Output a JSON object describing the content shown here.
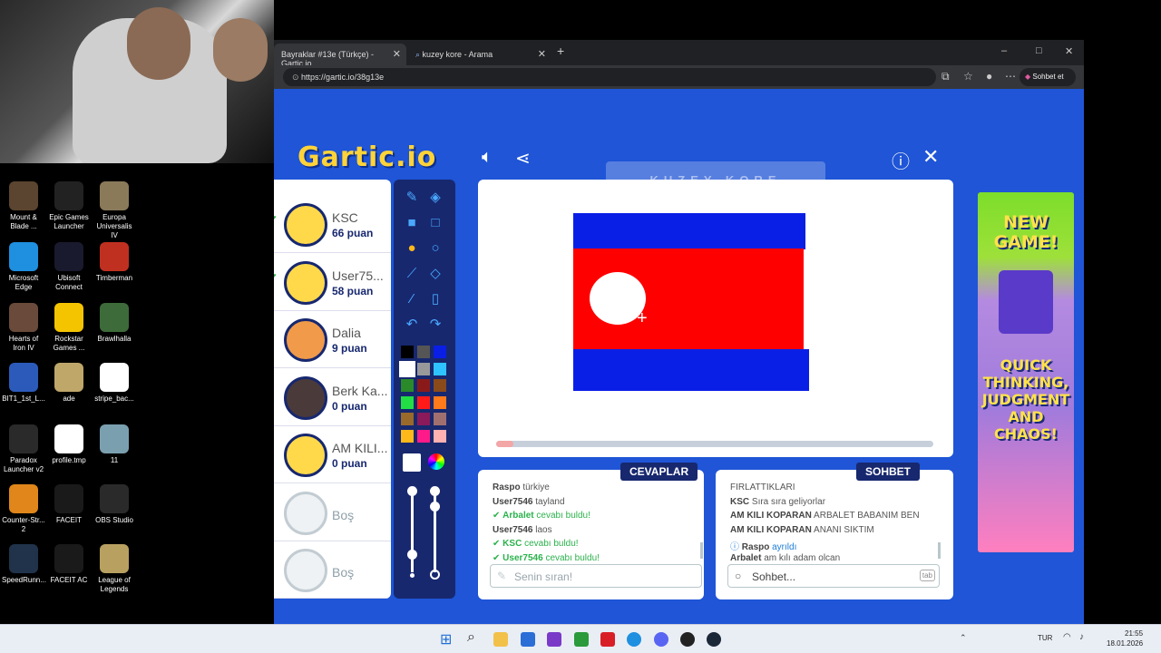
{
  "desktop": {
    "icons": [
      {
        "label": "Mount & Blade ...",
        "color": "#5b4530"
      },
      {
        "label": "Epic Games Launcher",
        "color": "#222222"
      },
      {
        "label": "Europa Universalis IV",
        "color": "#8a7a5a"
      },
      {
        "label": "Microsoft Edge",
        "color": "#1f8fe0"
      },
      {
        "label": "Ubisoft Connect",
        "color": "#1a1a2e"
      },
      {
        "label": "Timberman",
        "color": "#c03020"
      },
      {
        "label": "Hearts of Iron IV",
        "color": "#6a4a3a"
      },
      {
        "label": "Rockstar Games ...",
        "color": "#f5c400"
      },
      {
        "label": "Brawlhalla",
        "color": "#3d6b3a"
      },
      {
        "label": "BIT1_1st_L...",
        "color": "#2b5aba"
      },
      {
        "label": "ade",
        "color": "#bfa76a"
      },
      {
        "label": "stripe_bac...",
        "color": "#ffffff"
      },
      {
        "label": "Paradox Launcher v2",
        "color": "#2a2a2a"
      },
      {
        "label": "profile.tmp",
        "color": "#ffffff"
      },
      {
        "label": "11",
        "color": "#7aa0b0"
      },
      {
        "label": "Counter-Str... 2",
        "color": "#e0861a"
      },
      {
        "label": "FACEIT",
        "color": "#1a1a1a"
      },
      {
        "label": "OBS Studio",
        "color": "#2a2a2a"
      },
      {
        "label": "SpeedRunn...",
        "color": "#20334a"
      },
      {
        "label": "FACEIT AC",
        "color": "#1a1a1a"
      },
      {
        "label": "League of Legends",
        "color": "#b8a060"
      }
    ]
  },
  "browser": {
    "tabs": [
      {
        "title": "Bayraklar #13e (Türkçe) - Gartic.io"
      },
      {
        "title": "kuzey kore - Arama"
      }
    ],
    "new_tab_icon": "+",
    "window_controls": {
      "minimize": "–",
      "maximize": "□",
      "close": "✕"
    },
    "url": "https://gartic.io/38g13e",
    "copilot_label": "Sohbet et"
  },
  "game": {
    "logo": "Gartic.io",
    "hint": "KUZEY KORE",
    "players": [
      {
        "name": "KSC",
        "points": "66 puan",
        "guessed": true,
        "avatar_color": "#ffd94a"
      },
      {
        "name": "User75...",
        "points": "58 puan",
        "guessed": true,
        "avatar_color": "#ffd94a"
      },
      {
        "name": "Dalia",
        "points": "9 puan",
        "guessed": false,
        "avatar_color": "#f09a4a"
      },
      {
        "name": "Berk Ka...",
        "points": "0 puan",
        "guessed": false,
        "avatar_color": "#4a3a3a"
      },
      {
        "name": "AM KILI...",
        "points": "0 puan",
        "guessed": false,
        "avatar_color": "#ffd94a"
      },
      {
        "name": "Boş",
        "points": "",
        "guessed": false,
        "empty": true
      },
      {
        "name": "Boş",
        "points": "",
        "guessed": false,
        "empty": true
      }
    ],
    "palette": [
      "#000000",
      "#555555",
      "#0a1fe6",
      "#ffffff",
      "#999999",
      "#2ec3ff",
      "#2a8a2a",
      "#8a1a1a",
      "#8a4a1a",
      "#22dd44",
      "#ff1a1a",
      "#ff7a1a",
      "#9a6a2a",
      "#8a1a5a",
      "#a07070",
      "#ffb81a",
      "#ff1a8a",
      "#ffb0b0"
    ],
    "progress": 0.04,
    "answers": {
      "title": "CEVAPLAR",
      "messages": [
        {
          "user": "Raspo",
          "text": "türkiye",
          "type": "normal"
        },
        {
          "user": "User7546",
          "text": "tayland",
          "type": "normal"
        },
        {
          "user": "Arbalet",
          "text": "cevabı buldu!",
          "type": "ok"
        },
        {
          "user": "User7546",
          "text": "laos",
          "type": "normal"
        },
        {
          "user": "KSC",
          "text": "cevabı buldu!",
          "type": "ok"
        },
        {
          "user": "User7546",
          "text": "cevabı buldu!",
          "type": "ok"
        }
      ],
      "placeholder": "Senin sıran!"
    },
    "chat": {
      "title": "SOHBET",
      "messages": [
        {
          "user": "",
          "text": "FIRLATTIKLARI",
          "type": "normal"
        },
        {
          "user": "KSC",
          "text": "Sıra sıra geliyorlar",
          "type": "normal"
        },
        {
          "user": "AM KILI KOPARAN",
          "text": "ARBALET BABANIM BEN",
          "type": "normal"
        },
        {
          "user": "AM KILI KOPARAN",
          "text": "ANANI SIKTIM",
          "type": "normal"
        },
        {
          "user": "Raspo",
          "text": "ayrıldı",
          "type": "info"
        },
        {
          "user": "Arbalet",
          "text": "am kılı adam olcan",
          "type": "normal"
        }
      ],
      "placeholder": "Sohbet...",
      "tab_hint": "tab"
    },
    "ad": {
      "line1": "NEW GAME!",
      "line2": "QUICK THINKING, JUDGMENT AND CHAOS!"
    }
  },
  "taskbar": {
    "language": "TUR",
    "time": "21:55",
    "date": "18.01.2026"
  }
}
